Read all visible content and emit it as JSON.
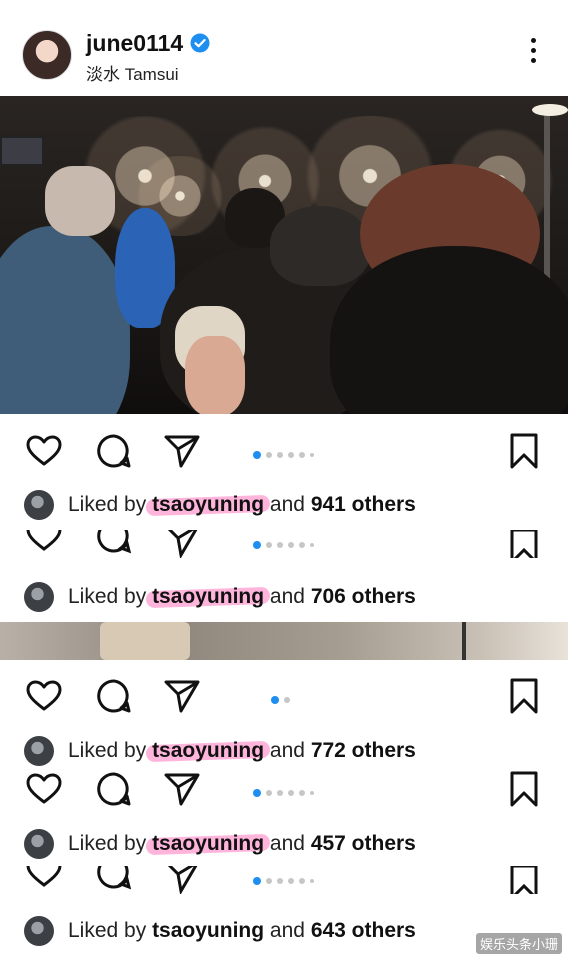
{
  "post": {
    "username": "june0114",
    "location": "淡水 Tamsui",
    "verified_icon": "verified-badge-icon",
    "more_icon": "more-options-icon"
  },
  "actions": {
    "like_icon": "heart-icon",
    "comment_icon": "comment-icon",
    "share_icon": "send-icon",
    "save_icon": "bookmark-icon"
  },
  "likes_rows": [
    {
      "prefix": "Liked by",
      "user": "tsaoyuning",
      "middle": "and",
      "count": "941 others"
    },
    {
      "prefix": "Liked by",
      "user": "tsaoyuning",
      "middle": "and",
      "count": "706 others"
    },
    {
      "prefix": "Liked by",
      "user": "tsaoyuning",
      "middle": "and",
      "count": "772 others"
    },
    {
      "prefix": "Liked by",
      "user": "tsaoyuning",
      "middle": "and",
      "count": "457 others"
    },
    {
      "prefix": "Liked by",
      "user": "tsaoyuning",
      "middle": "and",
      "count": "643 others"
    }
  ],
  "watermark": "娱乐头条小珊",
  "colors": {
    "accent": "#1d8ff0",
    "highlight": "#ff78be"
  }
}
